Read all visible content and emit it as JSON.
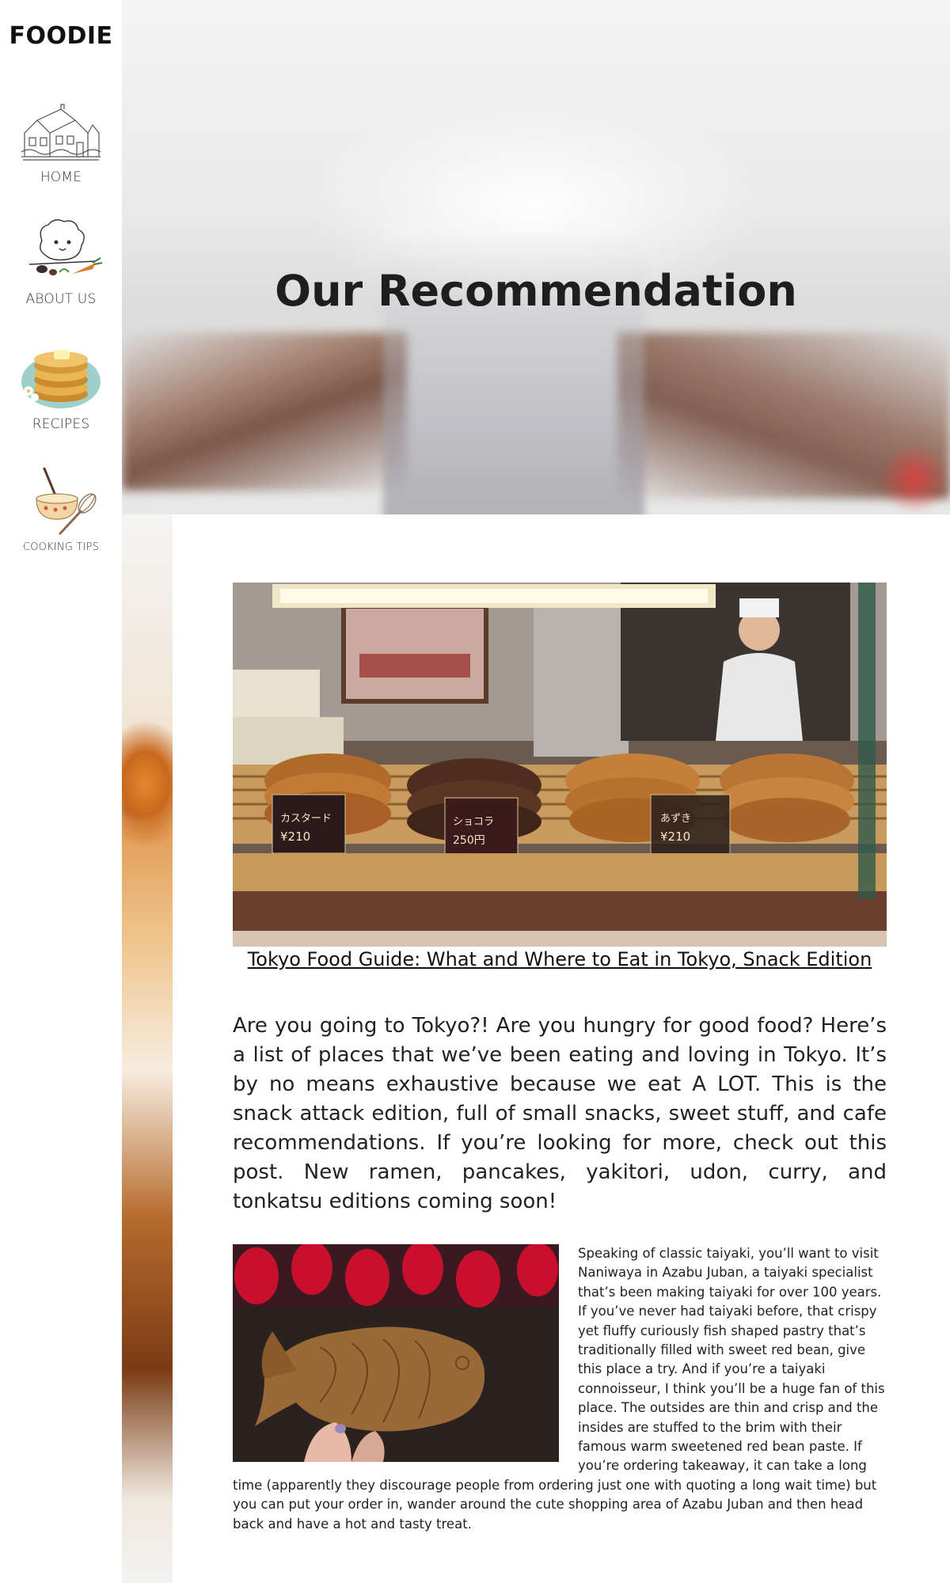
{
  "brand": {
    "logo": "FOODIE"
  },
  "sidebar": {
    "items": [
      {
        "label": "HOME",
        "icon": "house-sketch-icon"
      },
      {
        "label": "ABOUT US",
        "icon": "dog-chef-icon"
      },
      {
        "label": "RECIPES",
        "icon": "pancake-stack-icon"
      },
      {
        "label": "COOKING TIPS",
        "icon": "mixing-bowl-whisk-icon"
      }
    ]
  },
  "hero": {
    "title": "Our Recommendation"
  },
  "article": {
    "image_alt": "Taiyaki pastries displayed in a shop case",
    "price_tags": [
      {
        "name": "カスタード",
        "price": "¥210"
      },
      {
        "name": "ショコラ",
        "price": "250円"
      },
      {
        "name": "あずき",
        "price": "¥210"
      }
    ],
    "caption": "Tokyo Food Guide: What and Where to Eat in Tokyo, Snack Edition",
    "intro": "Are you going to Tokyo?! Are you hungry for good food? Here’s a list of places that we’ve been eating and loving in Tokyo. It’s by no means exhaustive because we eat A LOT. This is the snack attack edition, full of small snacks, sweet stuff, and cafe recommendations. If you’re looking for more, check out this post. New ramen, pancakes, yakitori, udon, curry, and tonkatsu editions coming soon!",
    "second_image_alt": "Hand holding a fish-shaped taiyaki",
    "body": "Speaking of classic taiyaki, you’ll want to visit Naniwaya in Azabu Juban, a taiyaki specialist that’s been making taiyaki for over 100 years. If you’ve never had taiyaki before, that crispy yet fluffy curiously fish shaped pastry that’s traditionally filled with sweet red bean, give this place a try. And if you’re a taiyaki connoisseur, I think you’ll be a huge fan of this place. The outsides are thin and crisp and the insides are stuffed to the brim with their famous warm sweetened red bean paste. If you’re ordering takeaway, it can take a long time (apparently they discourage people from ordering just one with quoting a long wait time) but you can put your order in, wander around the cute shopping area of Azabu Juban and then head back and have a hot and tasty treat."
  }
}
